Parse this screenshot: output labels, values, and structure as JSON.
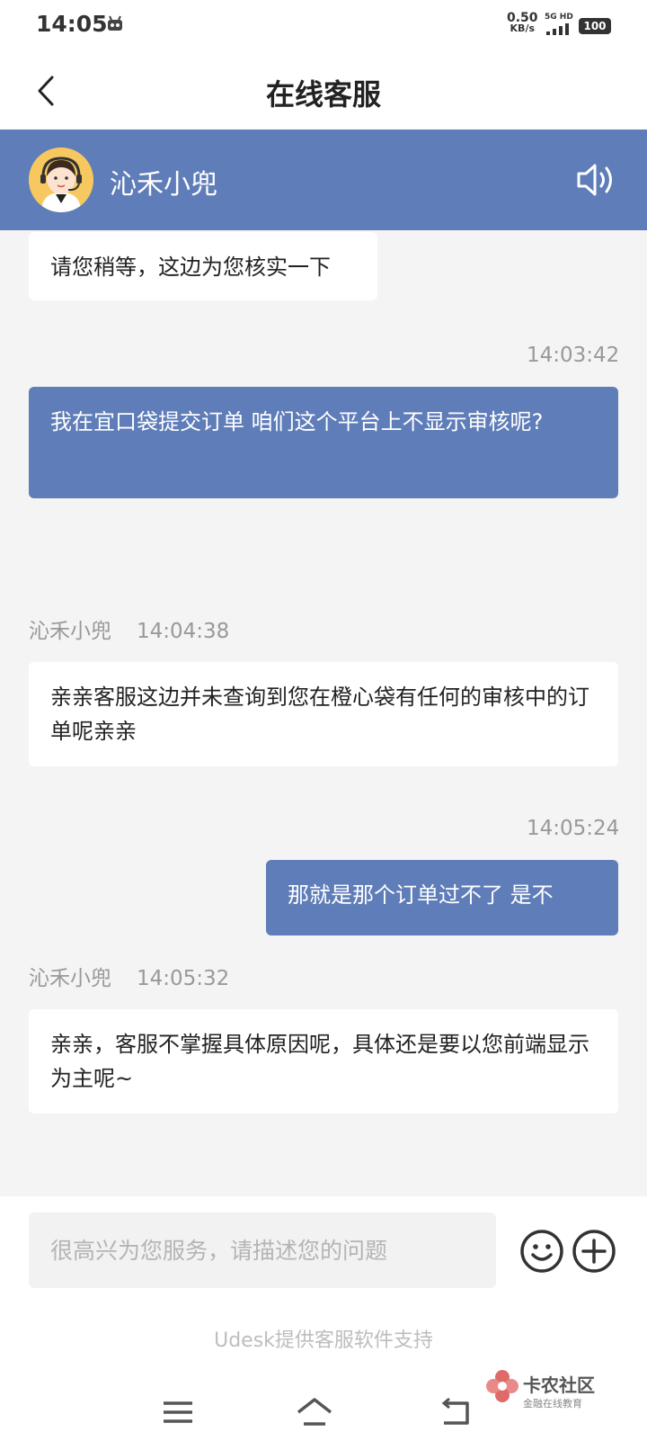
{
  "status_bar": {
    "time": "14:05",
    "net_speed": "0.50",
    "net_unit": "KB/s",
    "network_type": "5G HD",
    "battery": "100"
  },
  "nav": {
    "title": "在线客服",
    "back_icon": "chevron-left-icon"
  },
  "agent": {
    "name": "沁禾小兜",
    "avatar_icon": "support-agent-avatar",
    "speaker_icon": "speaker-icon"
  },
  "messages": [
    {
      "from": "agent",
      "text": "请您稍等，这边为您核实一下"
    },
    {
      "from": "user",
      "time": "14:03:42",
      "text": "我在宜口袋提交订单 咱们这个平台上不显示审核呢?"
    },
    {
      "from": "agent",
      "sender": "沁禾小兜",
      "time": "14:04:38",
      "text": "亲亲客服这边并未查询到您在橙心袋有任何的审核中的订单呢亲亲"
    },
    {
      "from": "user",
      "time": "14:05:24",
      "text": "那就是那个订单过不了 是不"
    },
    {
      "from": "agent",
      "sender": "沁禾小兜",
      "time": "14:05:32",
      "text": "亲亲，客服不掌握具体原因呢，具体还是要以您前端显示为主呢~"
    }
  ],
  "input": {
    "value": "",
    "placeholder": "很高兴为您服务，请描述您的问题"
  },
  "powered_by": "Udesk提供客服软件支持",
  "watermark": {
    "title": "卡农社区",
    "subtitle": "金融在线教育"
  },
  "colors": {
    "accent": "#5f7db8",
    "background": "#f4f4f4"
  }
}
